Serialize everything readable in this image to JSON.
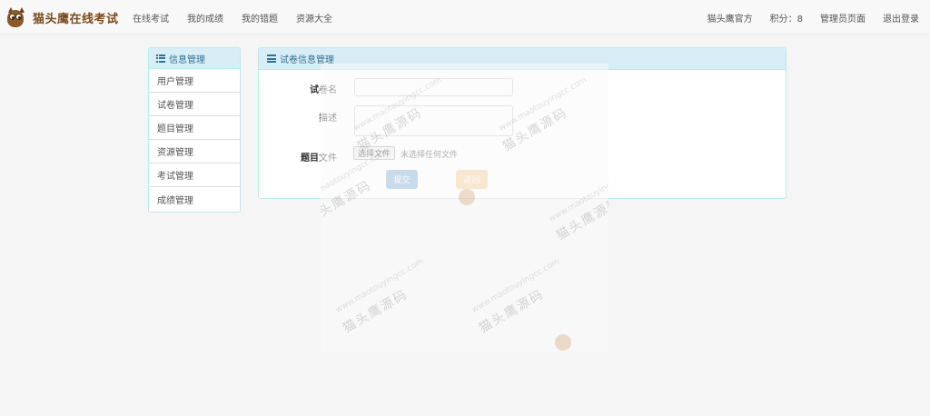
{
  "brand": {
    "name": "猫头鹰在线考试"
  },
  "nav": {
    "left": [
      "在线考试",
      "我的成绩",
      "我的错题",
      "资源大全"
    ],
    "user": "猫头鹰官方",
    "points": "积分：8",
    "admin": "管理员页面",
    "logout": "退出登录"
  },
  "sidebar": {
    "title": "信息管理",
    "items": [
      "用户管理",
      "试卷管理",
      "题目管理",
      "资源管理",
      "考试管理",
      "成绩管理"
    ]
  },
  "panel": {
    "title": "试卷信息管理"
  },
  "form": {
    "name_label_bold": "试",
    "name_label_rest": "卷名",
    "desc_label": "描述",
    "file_label_bold": "题目",
    "file_label_rest": "文件",
    "file_button": "选择文件",
    "file_none": "未选择任何文件",
    "submit": "提交",
    "back": "返回"
  },
  "watermark": {
    "url": "www.maotouyingcc.com",
    "text": "猫头鹰源码"
  },
  "colors": {
    "panel_head_bg": "#d9edf7",
    "panel_border": "#bce8f1",
    "primary": "#337ab7",
    "warning": "#f0ad4e",
    "brand": "#7a4a1a"
  }
}
